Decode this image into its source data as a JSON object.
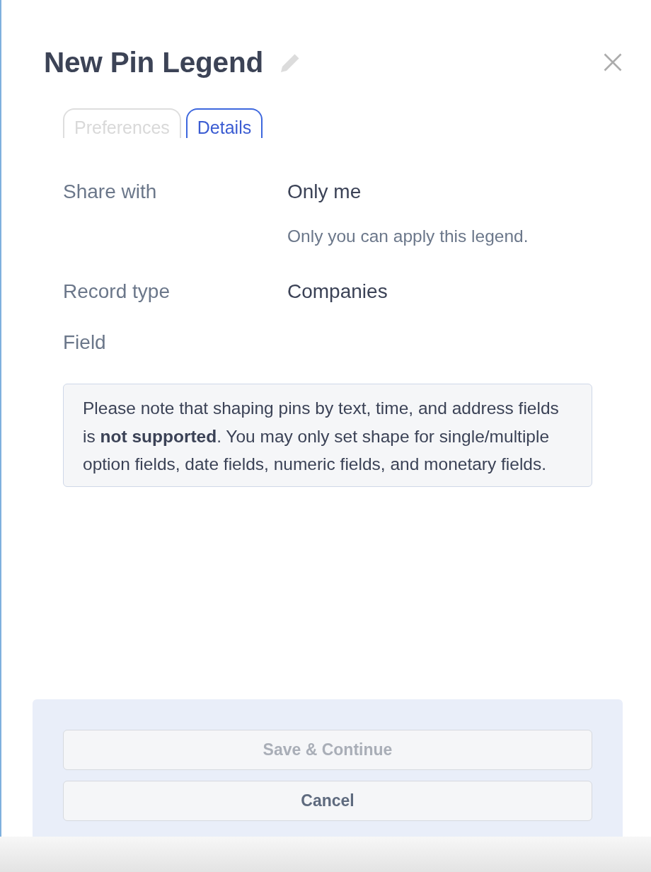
{
  "dialog": {
    "title": "New Pin Legend"
  },
  "tabs": [
    {
      "label": "Preferences",
      "selected": false
    },
    {
      "label": "Details",
      "selected": true
    }
  ],
  "fields": [
    {
      "label": "Share with",
      "value": "Only me",
      "hint": "Only you can apply this legend."
    },
    {
      "label": "Record type",
      "value": "Companies"
    },
    {
      "label": "Field"
    }
  ],
  "notice": "Please note that shaping pins by text, time, and address fields is **not supported**. You may only set shape for single/multiple option fields, date fields, numeric fields, and monetary fields.",
  "buttons": [
    {
      "label": "Save & Continue",
      "disabled": true
    },
    {
      "label": "Cancel",
      "disabled": false
    }
  ]
}
